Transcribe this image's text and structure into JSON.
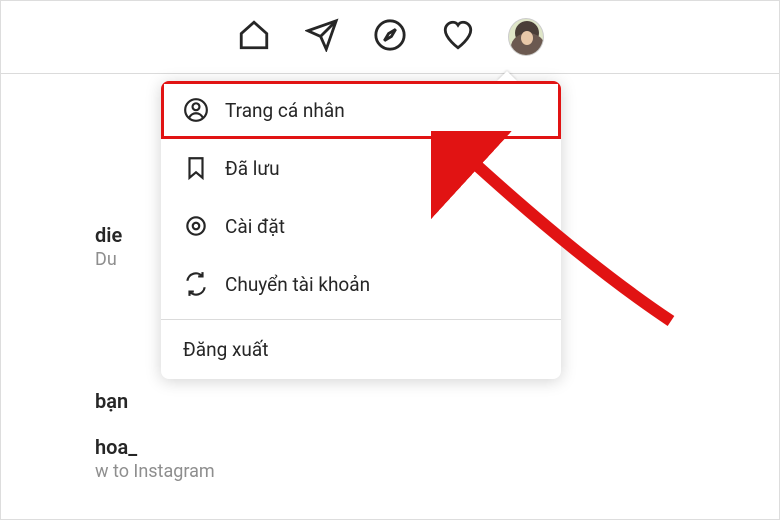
{
  "nav_icons": {
    "home": "home-icon",
    "direct": "send-icon",
    "explore": "compass-icon",
    "activity": "heart-icon",
    "profile": "profile-avatar"
  },
  "menu": {
    "profile": "Trang cá nhân",
    "saved": "Đã lưu",
    "settings": "Cài đặt",
    "switch": "Chuyển tài khoản",
    "logout": "Đăng xuất"
  },
  "background": {
    "line1": "die",
    "line2": "Du",
    "line3": "bạn",
    "line4": "hoa_",
    "line5": "w to Instagram"
  }
}
